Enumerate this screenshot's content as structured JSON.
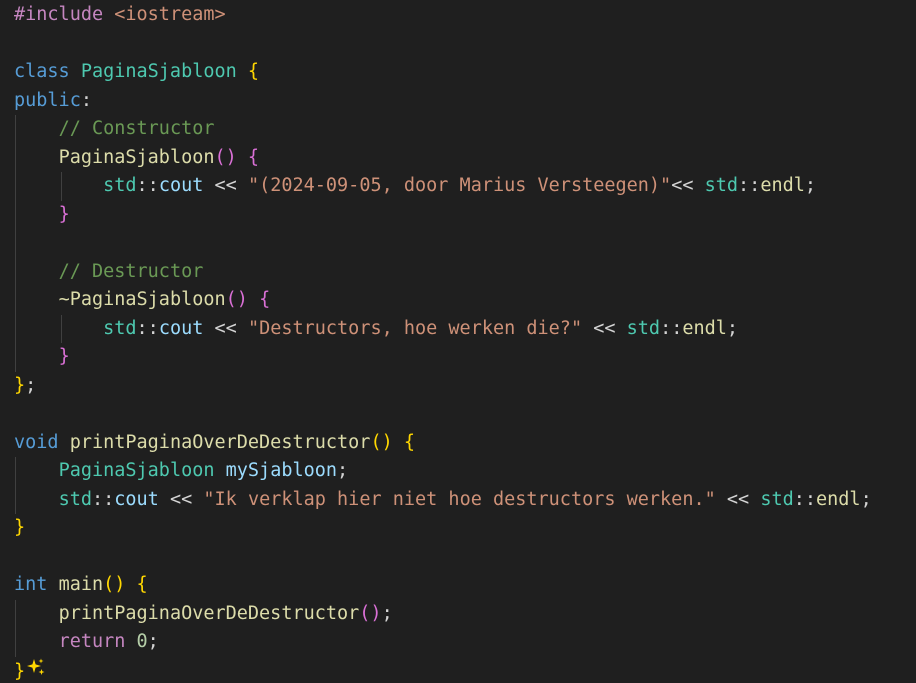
{
  "editor": {
    "language": "cpp",
    "colors": {
      "background": "#1f1f1f",
      "keyword": "#569cd6",
      "type": "#4ec9b0",
      "function": "#dcdcaa",
      "string": "#ce9178",
      "comment": "#6a9955",
      "preprocessor": "#c586c0",
      "bracket_level_1": "#ffd700",
      "bracket_level_2": "#da70d6",
      "bracket_level_3": "#179fff"
    },
    "lines": [
      {
        "guides": 0,
        "tokens": [
          [
            "pre",
            "#include "
          ],
          [
            "inc",
            "<iostream>"
          ]
        ]
      },
      {
        "guides": 0,
        "tokens": []
      },
      {
        "guides": 0,
        "tokens": [
          [
            "kw",
            "class "
          ],
          [
            "type",
            "PaginaSjabloon "
          ],
          [
            "b1",
            "{"
          ]
        ]
      },
      {
        "guides": 0,
        "tokens": [
          [
            "kw",
            "public"
          ],
          [
            "op",
            ":"
          ]
        ]
      },
      {
        "guides": 1,
        "tokens": [
          [
            "op",
            "    "
          ],
          [
            "com",
            "// Constructor"
          ]
        ]
      },
      {
        "guides": 1,
        "tokens": [
          [
            "op",
            "    "
          ],
          [
            "fn",
            "PaginaSjabloon"
          ],
          [
            "b2",
            "()"
          ],
          [
            "op",
            " "
          ],
          [
            "b2",
            "{"
          ]
        ]
      },
      {
        "guides": 2,
        "tokens": [
          [
            "op",
            "        "
          ],
          [
            "type",
            "std"
          ],
          [
            "op",
            "::"
          ],
          [
            "var",
            "cout"
          ],
          [
            "op",
            " << "
          ],
          [
            "str",
            "\"(2024-09-05, door Marius Versteegen)\""
          ],
          [
            "op",
            "<< "
          ],
          [
            "type",
            "std"
          ],
          [
            "op",
            "::"
          ],
          [
            "fn",
            "endl"
          ],
          [
            "op",
            ";"
          ]
        ]
      },
      {
        "guides": 1,
        "tokens": [
          [
            "op",
            "    "
          ],
          [
            "b2",
            "}"
          ]
        ]
      },
      {
        "guides": 1,
        "tokens": []
      },
      {
        "guides": 1,
        "tokens": [
          [
            "op",
            "    "
          ],
          [
            "com",
            "// Destructor"
          ]
        ]
      },
      {
        "guides": 1,
        "tokens": [
          [
            "op",
            "    "
          ],
          [
            "fn",
            "~PaginaSjabloon"
          ],
          [
            "b2",
            "()"
          ],
          [
            "op",
            " "
          ],
          [
            "b2",
            "{"
          ]
        ]
      },
      {
        "guides": 2,
        "tokens": [
          [
            "op",
            "        "
          ],
          [
            "type",
            "std"
          ],
          [
            "op",
            "::"
          ],
          [
            "var",
            "cout"
          ],
          [
            "op",
            " << "
          ],
          [
            "str",
            "\"Destructors, hoe werken die?\""
          ],
          [
            "op",
            " << "
          ],
          [
            "type",
            "std"
          ],
          [
            "op",
            "::"
          ],
          [
            "fn",
            "endl"
          ],
          [
            "op",
            ";"
          ]
        ]
      },
      {
        "guides": 1,
        "tokens": [
          [
            "op",
            "    "
          ],
          [
            "b2",
            "}"
          ]
        ]
      },
      {
        "guides": 0,
        "tokens": [
          [
            "b1",
            "}"
          ],
          [
            "op",
            ";"
          ]
        ]
      },
      {
        "guides": 0,
        "tokens": []
      },
      {
        "guides": 0,
        "tokens": [
          [
            "kw",
            "void "
          ],
          [
            "fn",
            "printPaginaOverDeDestructor"
          ],
          [
            "b1",
            "()"
          ],
          [
            "op",
            " "
          ],
          [
            "b1",
            "{"
          ]
        ]
      },
      {
        "guides": 1,
        "tokens": [
          [
            "op",
            "    "
          ],
          [
            "type",
            "PaginaSjabloon "
          ],
          [
            "var",
            "mySjabloon"
          ],
          [
            "op",
            ";"
          ]
        ]
      },
      {
        "guides": 1,
        "tokens": [
          [
            "op",
            "    "
          ],
          [
            "type",
            "std"
          ],
          [
            "op",
            "::"
          ],
          [
            "var",
            "cout"
          ],
          [
            "op",
            " << "
          ],
          [
            "str",
            "\"Ik verklap hier niet hoe destructors werken.\""
          ],
          [
            "op",
            " << "
          ],
          [
            "type",
            "std"
          ],
          [
            "op",
            "::"
          ],
          [
            "fn",
            "endl"
          ],
          [
            "op",
            ";"
          ]
        ]
      },
      {
        "guides": 0,
        "tokens": [
          [
            "b1",
            "}"
          ]
        ]
      },
      {
        "guides": 0,
        "tokens": []
      },
      {
        "guides": 0,
        "tokens": [
          [
            "kw",
            "int "
          ],
          [
            "fn",
            "main"
          ],
          [
            "b1",
            "()"
          ],
          [
            "op",
            " "
          ],
          [
            "b1",
            "{"
          ]
        ]
      },
      {
        "guides": 1,
        "tokens": [
          [
            "op",
            "    "
          ],
          [
            "fn",
            "printPaginaOverDeDestructor"
          ],
          [
            "b2",
            "()"
          ],
          [
            "op",
            ";"
          ]
        ]
      },
      {
        "guides": 1,
        "tokens": [
          [
            "op",
            "    "
          ],
          [
            "ctl",
            "return "
          ],
          [
            "num",
            "0"
          ],
          [
            "op",
            ";"
          ]
        ]
      },
      {
        "guides": 0,
        "tokens": [
          [
            "b1",
            "}"
          ],
          [
            "icon",
            "sparkle-icon"
          ]
        ]
      }
    ]
  }
}
